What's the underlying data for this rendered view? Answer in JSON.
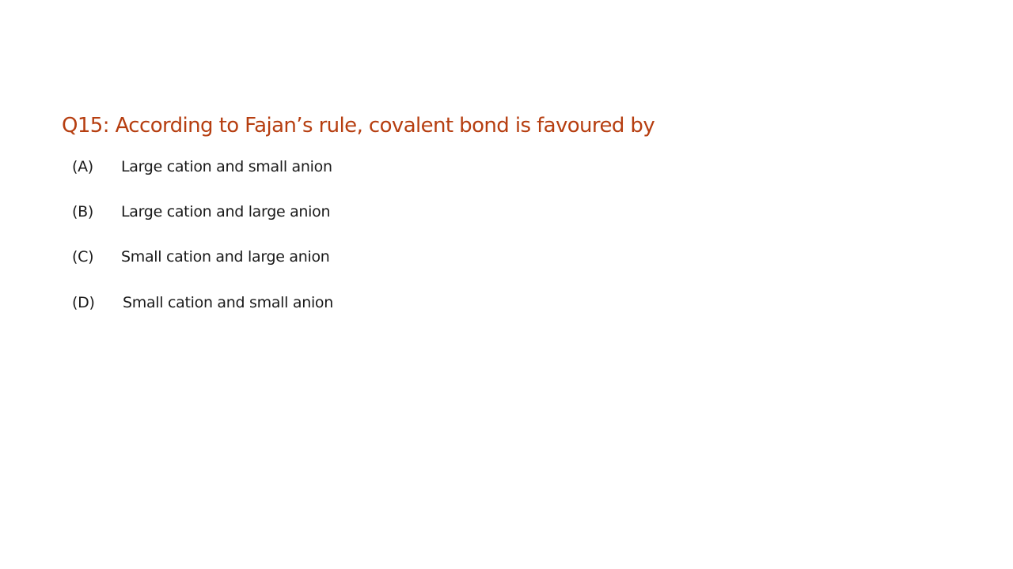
{
  "colors": {
    "title": "#b63e10",
    "text": "#1a1a1a",
    "background": "#ffffff"
  },
  "question": {
    "title": "Q15: According to Fajan’s rule, covalent bond is favoured by",
    "options": [
      {
        "label": "(A)",
        "text": "Large cation and small anion"
      },
      {
        "label": "(B)",
        "text": "Large cation and large anion"
      },
      {
        "label": "(C)",
        "text": "Small cation and large anion"
      },
      {
        "label": "(D)",
        "text": "Small cation and small anion"
      }
    ]
  }
}
